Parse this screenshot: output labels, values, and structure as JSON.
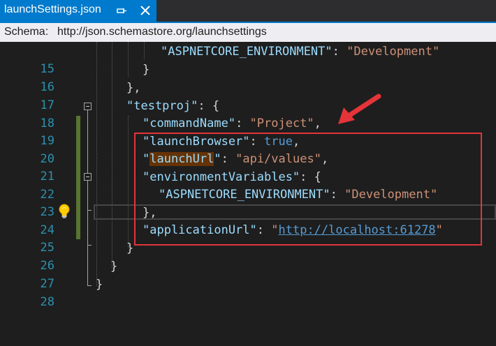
{
  "tab": {
    "title": "launchSettings.json",
    "pin_icon": "pin-icon",
    "close_icon": "close-icon"
  },
  "schema": {
    "label": "Schema:",
    "url": "http://json.schemastore.org/launchsettings"
  },
  "lines": [
    {
      "n": "15"
    },
    {
      "n": "16"
    },
    {
      "n": "17"
    },
    {
      "n": "18"
    },
    {
      "n": "19"
    },
    {
      "n": "20"
    },
    {
      "n": "21"
    },
    {
      "n": "22"
    },
    {
      "n": "23"
    },
    {
      "n": "24"
    },
    {
      "n": "25"
    },
    {
      "n": "26"
    },
    {
      "n": "27"
    },
    {
      "n": "28"
    }
  ],
  "code": {
    "l15_key": "\"ASPNETCORE_ENVIRONMENT\"",
    "l15_val": "\"Development\"",
    "l16": "}",
    "l17": "},",
    "l18_key": "\"testproj\"",
    "l18_rest": ": {",
    "l19_key": "\"commandName\"",
    "l19_val": "\"Project\"",
    "l20_key": "\"launchBrowser\"",
    "l20_val": "true",
    "l21_q1": "\"",
    "l21_key": "launchUrl",
    "l21_q2": "\"",
    "l21_val": "\"api/values\"",
    "l22_key": "\"environmentVariables\"",
    "l22_rest": ": {",
    "l23_key": "\"ASPNETCORE_ENVIRONMENT\"",
    "l23_val": "\"Development\"",
    "l24": "},",
    "l25_key": "\"applicationUrl\"",
    "l25_q1": "\"",
    "l25_url": "http://localhost:61278",
    "l25_q2": "\"",
    "l26": "}",
    "l27": "}",
    "l28": "}"
  },
  "colors": {
    "tab_active": "#007acc",
    "annotation": "#e4343a",
    "string": "#ce9178",
    "key": "#9cdcfe",
    "keyword": "#569cd6",
    "line_number": "#2b91af"
  },
  "icons": {
    "lightbulb": "lightbulb-icon",
    "arrow": "red-arrow-icon"
  }
}
